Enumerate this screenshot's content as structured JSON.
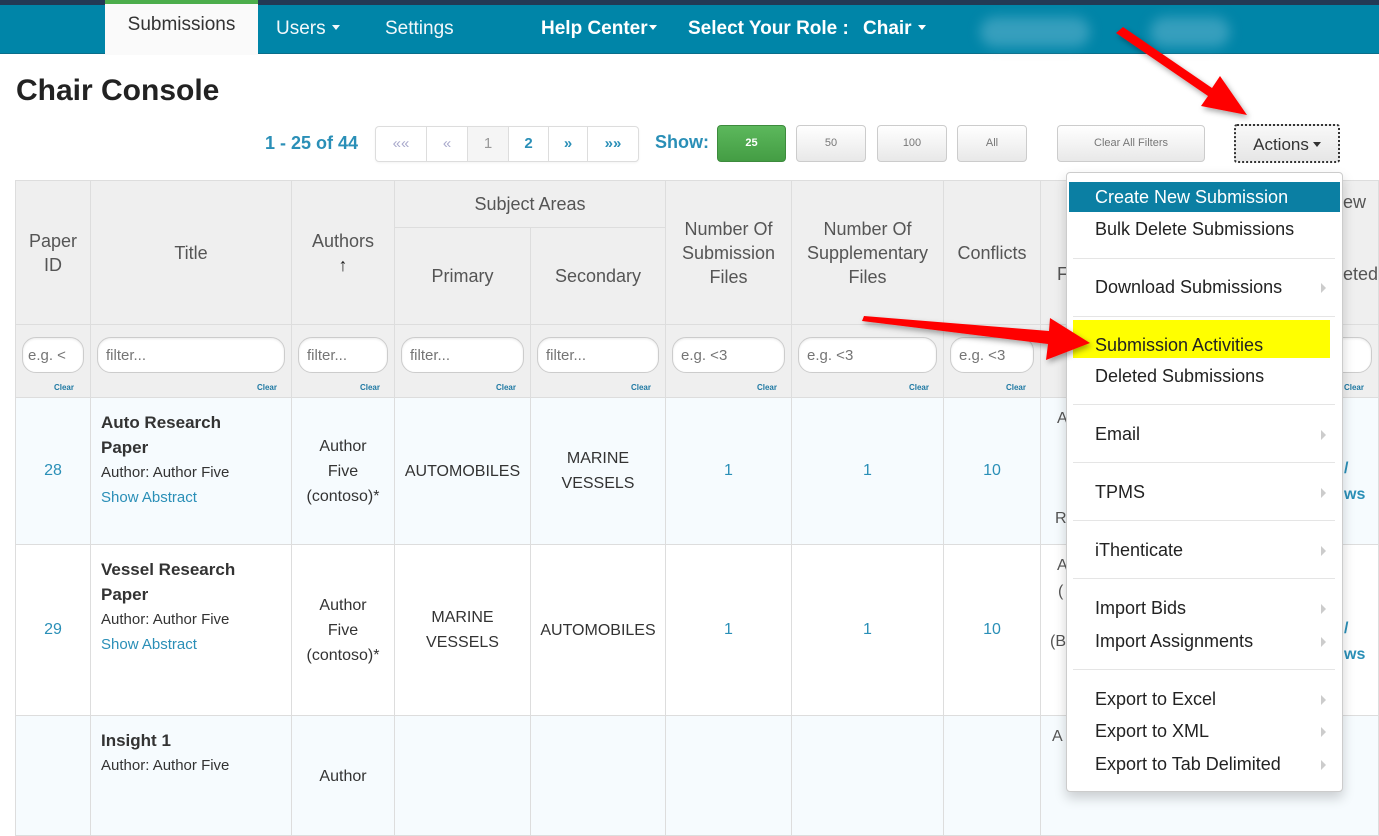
{
  "nav": {
    "items": [
      {
        "label": "Submissions",
        "active": true
      },
      {
        "label": "Users",
        "has_caret": true
      },
      {
        "label": "Settings"
      },
      {
        "label": "Help Center",
        "has_caret": true
      },
      {
        "label": "Select Your Role :"
      },
      {
        "label": "Chair",
        "has_caret": true
      }
    ]
  },
  "page": {
    "title": "Chair Console"
  },
  "pagination": {
    "range_text": "1 - 25 of 44",
    "buttons": [
      "««",
      "«",
      "1",
      "2",
      "»",
      "»»"
    ],
    "current_page": "1"
  },
  "show": {
    "label": "Show:",
    "options": [
      "25",
      "50",
      "100",
      "All"
    ],
    "selected": "25"
  },
  "toolbar": {
    "clear_filters_label": "Clear All Filters",
    "actions_label": "Actions"
  },
  "table": {
    "headers": {
      "paper_id": "Paper ID",
      "title": "Title",
      "authors": "Authors",
      "sort_icon": "↑",
      "subject_areas": "Subject Areas",
      "primary": "Primary",
      "secondary": "Secondary",
      "num_submission_files": "Number Of Submission Files",
      "num_supplementary_files": "Number Of Supplementary Files",
      "conflicts": "Conflicts"
    },
    "filters": {
      "paper_id": "e.g. <",
      "title": "filter...",
      "authors": "filter...",
      "primary": "filter...",
      "secondary": "filter...",
      "num_submission_files": "e.g. <3",
      "num_supplementary_files": "e.g. <3",
      "conflicts": "e.g. <3",
      "clear_label": "Clear"
    },
    "rows": [
      {
        "paper_id": "28",
        "title": "Auto Research Paper",
        "author_line": "Author: Author Five",
        "abstract_link": "Show Abstract",
        "authors": [
          "Author",
          "Five",
          "(contoso)*"
        ],
        "primary": [
          "AUTOMOBILES"
        ],
        "secondary": [
          "MARINE",
          "VESSELS"
        ],
        "num_submission_files": "1",
        "num_supplementary_files": "1",
        "conflicts": "10"
      },
      {
        "paper_id": "29",
        "title": "Vessel Research Paper",
        "author_line": "Author: Author Five",
        "abstract_link": "Show Abstract",
        "authors": [
          "Author",
          "Five",
          "(contoso)*"
        ],
        "primary": [
          "MARINE",
          "VESSELS"
        ],
        "secondary": [
          "AUTOMOBILES"
        ],
        "num_submission_files": "1",
        "num_supplementary_files": "1",
        "conflicts": "10"
      },
      {
        "paper_id": "",
        "title": "Insight 1",
        "author_line": "Author: Author Five",
        "abstract_link": "",
        "authors": [
          "Author"
        ],
        "primary": [],
        "secondary": [],
        "num_submission_files": "",
        "num_supplementary_files": "",
        "conflicts": ""
      }
    ],
    "clipped_right": {
      "header_fragments": [
        "ew",
        "eted",
        "F"
      ],
      "row_fragments": [
        "A",
        "R",
        "A",
        "(",
        "(B",
        "A"
      ],
      "link_fragments": [
        "/",
        "ws"
      ]
    }
  },
  "actions_menu": {
    "items": [
      {
        "label": "Create New Submission",
        "active": true
      },
      {
        "label": "Bulk Delete Submissions"
      },
      {
        "divider": true
      },
      {
        "label": "Download Submissions",
        "submenu": true
      },
      {
        "divider": true
      },
      {
        "label": "Submission Activities",
        "highlighted": true
      },
      {
        "label": "Deleted Submissions"
      },
      {
        "divider": true
      },
      {
        "label": "Email",
        "submenu": true
      },
      {
        "divider": true
      },
      {
        "label": "TPMS",
        "submenu": true
      },
      {
        "divider": true
      },
      {
        "label": "iThenticate",
        "submenu": true
      },
      {
        "divider": true
      },
      {
        "label": "Import Bids",
        "submenu": true
      },
      {
        "label": "Import Assignments",
        "submenu": true
      },
      {
        "divider": true
      },
      {
        "label": "Export to Excel",
        "submenu": true
      },
      {
        "label": "Export to XML",
        "submenu": true
      },
      {
        "label": "Export to Tab Delimited",
        "submenu": true
      }
    ]
  },
  "colors": {
    "nav_bg": "#0085a8",
    "link": "#2a8fb7",
    "active_page_size": "#5cb85c",
    "menu_active": "#0b7fa3",
    "highlight": "#ffff00",
    "annotation_arrow": "#ff0000"
  }
}
